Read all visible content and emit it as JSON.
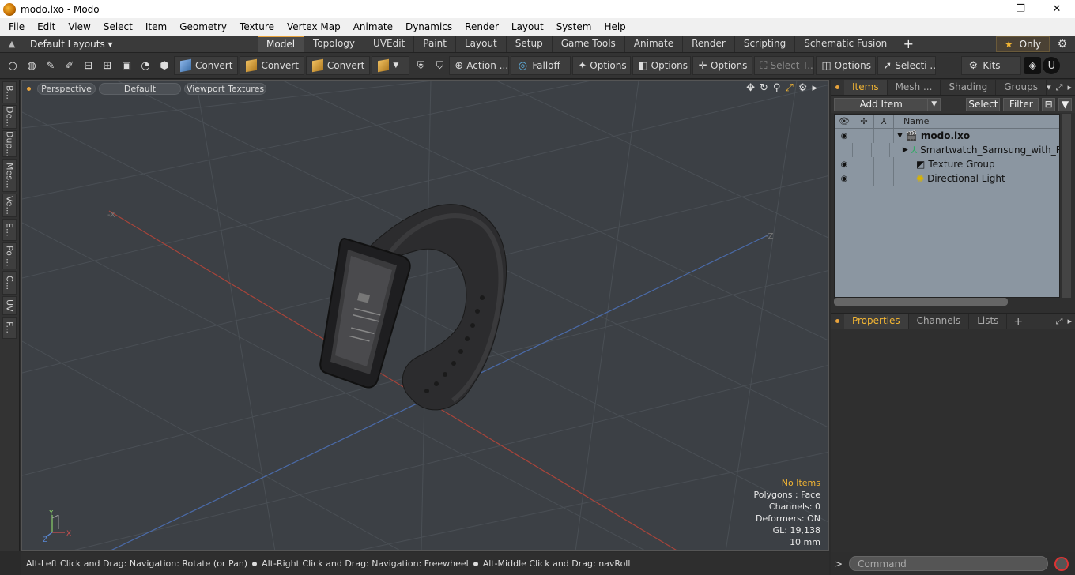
{
  "window": {
    "title": "modo.lxo - Modo",
    "controls": {
      "minimize": "—",
      "maximize": "❐",
      "close": "✕"
    }
  },
  "menu": [
    "File",
    "Edit",
    "View",
    "Select",
    "Item",
    "Geometry",
    "Texture",
    "Vertex Map",
    "Animate",
    "Dynamics",
    "Render",
    "Layout",
    "System",
    "Help"
  ],
  "layoutbar": {
    "layouts_label": "Default Layouts ▾",
    "tabs": [
      "Model",
      "Topology",
      "UVEdit",
      "Paint",
      "Layout",
      "Setup",
      "Game Tools",
      "Animate",
      "Render",
      "Scripting",
      "Schematic Fusion"
    ],
    "active_tab": "Model",
    "plus": "+",
    "only_label": "Only",
    "only_star": "★",
    "gear": "⚙"
  },
  "toolbar": {
    "convert1": "Convert",
    "convert2": "Convert",
    "convert3": "Convert",
    "action": "Action ...",
    "falloff": "Falloff",
    "options1": "Options",
    "options2": "Options",
    "options3": "Options",
    "select_t": "Select T...",
    "options4": "Options",
    "selecti": "Selecti ...",
    "kits": "Kits"
  },
  "left_tabs": [
    "B...",
    "De...",
    "Dup...",
    "Mes...",
    "Ve...",
    "E...",
    "Pol...",
    "C...",
    "UV",
    "F..."
  ],
  "viewport": {
    "view_mode": "Perspective",
    "style": "Default",
    "shading": "Viewport Textures",
    "axis_labels": {
      "neg_x": "-X",
      "neg_z": "-Z"
    },
    "gizmo": {
      "x": "X",
      "y": "Y",
      "z": "Z"
    },
    "stats": {
      "selection": "No Items",
      "polygons": "Polygons : Face",
      "channels": "Channels: 0",
      "deformers": "Deformers: ON",
      "gl": "GL: 19,138",
      "unit": "10 mm"
    }
  },
  "statusbar": {
    "hint1": "Alt-Left Click and Drag: Navigation: Rotate (or Pan)",
    "hint2": "Alt-Right Click and Drag: Navigation: Freewheel",
    "hint3": "Alt-Middle Click and Drag: navRoll"
  },
  "items_panel": {
    "tabs": [
      "Items",
      "Mesh ...",
      "Shading",
      "Groups"
    ],
    "active_tab": "Items",
    "add_item": "Add Item",
    "select": "Select",
    "filter": "Filter",
    "name_header": "Name",
    "rows": [
      {
        "name": "modo.lxo",
        "bold": true,
        "eye": true,
        "expand": "▼"
      },
      {
        "name": "Smartwatch_Samsung_with_R...",
        "bold": false,
        "eye": false,
        "expand": "▶"
      },
      {
        "name": "Texture Group",
        "bold": false,
        "eye": true,
        "expand": ""
      },
      {
        "name": "Directional Light",
        "bold": false,
        "eye": true,
        "expand": ""
      }
    ]
  },
  "props_panel": {
    "tabs": [
      "Properties",
      "Channels",
      "Lists"
    ],
    "active_tab": "Properties",
    "plus": "+"
  },
  "command": {
    "placeholder": "Command",
    "prompt": ">"
  },
  "colors": {
    "accent": "#e8a33c",
    "viewport_bg": "#3c4045",
    "list_bg": "#8b96a1"
  }
}
